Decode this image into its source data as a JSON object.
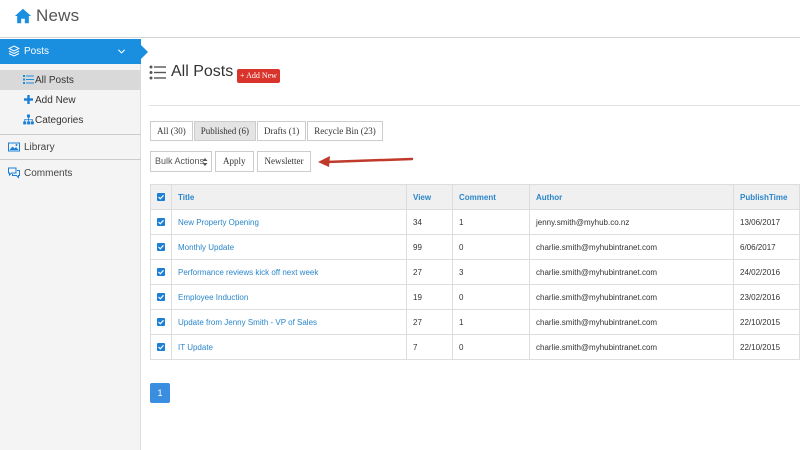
{
  "app": {
    "title": "News"
  },
  "sidebar": {
    "posts_label": "Posts",
    "sub_items": [
      {
        "label": "All Posts",
        "icon": "list-icon",
        "active": true
      },
      {
        "label": "Add New",
        "icon": "plus-icon",
        "active": false
      },
      {
        "label": "Categories",
        "icon": "sitemap-icon",
        "active": false
      }
    ],
    "library_label": "Library",
    "comments_label": "Comments"
  },
  "page": {
    "title": "All Posts",
    "add_new": "+ Add New"
  },
  "tabs": [
    {
      "label": "All (30)",
      "active": false
    },
    {
      "label": "Published (6)",
      "active": true
    },
    {
      "label": "Drafts (1)",
      "active": false
    },
    {
      "label": "Recycle Bin (23)",
      "active": false
    }
  ],
  "actions": {
    "bulk_actions": "Bulk Actions",
    "apply": "Apply",
    "newsletter": "Newsletter"
  },
  "table": {
    "headers": [
      "Title",
      "View",
      "Comment",
      "Author",
      "PublishTime"
    ],
    "rows": [
      {
        "title": "New Property Opening",
        "view": "34",
        "comment": "1",
        "author": "jenny.smith@myhub.co.nz",
        "publish_time": "13/06/2017"
      },
      {
        "title": "Monthly Update",
        "view": "99",
        "comment": "0",
        "author": "charlie.smith@myhubintranet.com",
        "publish_time": "6/06/2017"
      },
      {
        "title": "Performance reviews kick off next week",
        "view": "27",
        "comment": "3",
        "author": "charlie.smith@myhubintranet.com",
        "publish_time": "24/02/2016"
      },
      {
        "title": "Employee Induction",
        "view": "19",
        "comment": "0",
        "author": "charlie.smith@myhubintranet.com",
        "publish_time": "23/02/2016"
      },
      {
        "title": "Update from Jenny Smith - VP of Sales",
        "view": "27",
        "comment": "1",
        "author": "charlie.smith@myhubintranet.com",
        "publish_time": "22/10/2015"
      },
      {
        "title": "IT Update",
        "view": "7",
        "comment": "0",
        "author": "charlie.smith@myhubintranet.com",
        "publish_time": "22/10/2015"
      }
    ]
  },
  "pagination": {
    "current": "1"
  },
  "colors": {
    "accent": "#1a8fe0",
    "danger": "#d9342b",
    "link": "#2a86c9",
    "arrow": "#c0392b"
  }
}
